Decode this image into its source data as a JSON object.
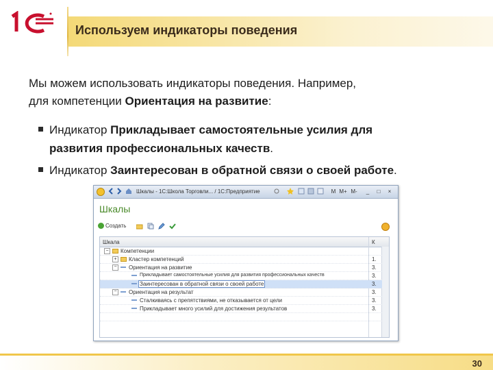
{
  "header": {
    "logo": "1С",
    "title": "Используем индикаторы поведения"
  },
  "intro": {
    "line1": "Мы можем использовать индикаторы поведения. Например,",
    "line2_prefix": "для компетенции ",
    "line2_bold": "Ориентация на развитие",
    "line2_suffix": ":"
  },
  "bullets": [
    {
      "prefix": "Индикатор ",
      "bold_line1": "Прикладывает самостоятельные усилия для",
      "bold_line2": "развития профессиональных качеств",
      "suffix": "."
    },
    {
      "prefix": "Индикатор ",
      "bold": "Заинтересован в обратной связи о своей работе",
      "suffix": "."
    }
  ],
  "window": {
    "title": "Шкалы - 1С:Школа Торговли... / 1С:Предприятие",
    "controls": [
      "M",
      "M+",
      "M-",
      "_",
      "□",
      "×"
    ],
    "form_title": "Шкалы",
    "create_label": "Создать",
    "columns": {
      "name": "Шкала",
      "code": "К"
    },
    "rows": [
      {
        "name": "Компетенции",
        "code": "",
        "level": 0,
        "icon": "minus"
      },
      {
        "name": "Кластер компетенций",
        "code": "1.",
        "level": 1,
        "icon": "folder"
      },
      {
        "name": "Ориентация на развитие",
        "code": "3.",
        "level": 1,
        "icon": "minus"
      },
      {
        "name": "Прикладывает самостоятельные усилия для развития профессиональных качеств",
        "code": "3.",
        "level": 2,
        "icon": "dash"
      },
      {
        "name": "Заинтересован в обратной связи о своей работе",
        "code": "3.",
        "level": 2,
        "icon": "dash",
        "selected": true
      },
      {
        "name": "Ориентация на результат",
        "code": "3.",
        "level": 1,
        "icon": "minus"
      },
      {
        "name": "Сталкиваясь с препятствиями, не отказывается от цели",
        "code": "3.",
        "level": 2,
        "icon": "dash"
      },
      {
        "name": "Прикладывает много усилий для достижения результатов",
        "code": "3.",
        "level": 2,
        "icon": "dash"
      },
      {
        "name": "",
        "code": "",
        "level": 1,
        "icon": ""
      }
    ]
  },
  "footer": {
    "page_number": "30"
  },
  "colors": {
    "accent": "#f0c64a",
    "logo_red": "#c8102e",
    "form_title": "#4a8a2a"
  }
}
